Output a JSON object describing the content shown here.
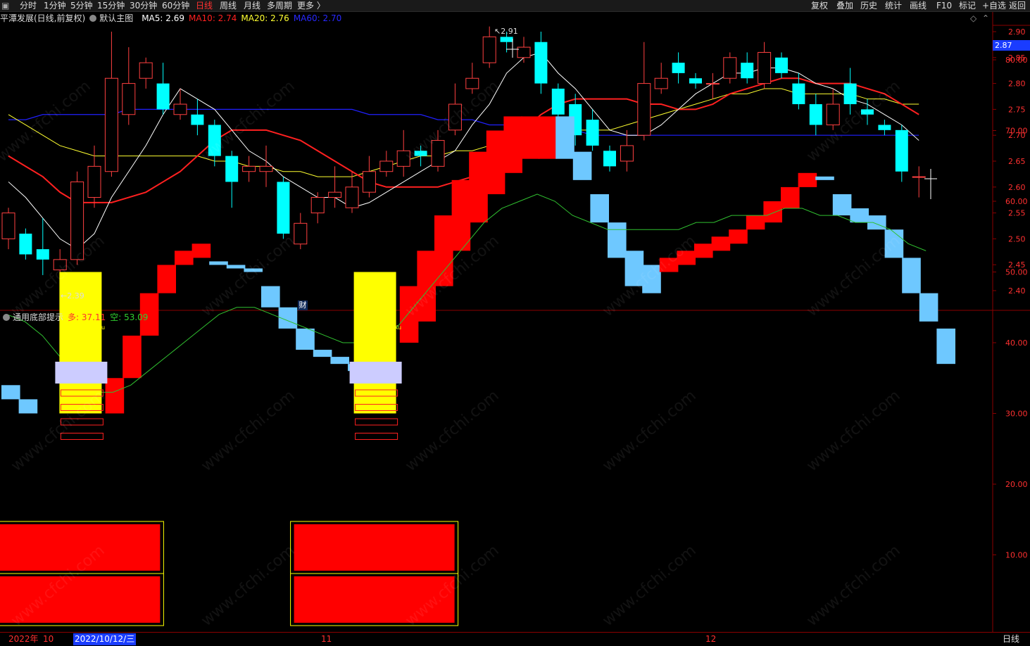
{
  "toolbar": {
    "left_items": [
      "分时",
      "1分钟",
      "5分钟",
      "15分钟",
      "30分钟",
      "60分钟",
      "日线",
      "周线",
      "月线",
      "多周期",
      "更多 〉"
    ],
    "active": "日线",
    "right_items": [
      "复权",
      "叠加",
      "历史",
      "统计",
      "画线",
      "F10",
      "标记",
      "+自选",
      "返回"
    ]
  },
  "main_chart": {
    "title": "平潭发展(日线,前复权)",
    "template": "默认主图",
    "ma5_label": "MA5: 2.69",
    "ma10_label": "MA10: 2.74",
    "ma20_label": "MA20: 2.76",
    "ma60_label": "MA60: 2.70",
    "colors": {
      "ma5": "#ffffff",
      "ma10": "#ff2020",
      "ma20": "#ffff30",
      "ma60": "#2020ff",
      "up": "#ff4040",
      "down": "#00ffff"
    },
    "price_ticks": [
      "2.90",
      "2.85",
      "2.80",
      "2.75",
      "2.70",
      "2.65",
      "2.60",
      "2.55",
      "2.50",
      "2.45",
      "2.40"
    ],
    "current_price": "2.87",
    "high_marker": "2.91",
    "low_marker": "2.39",
    "fin_marker": "财",
    "candles": [
      [
        2.5,
        2.55,
        2.48,
        2.56
      ],
      [
        2.51,
        2.47,
        2.46,
        2.52
      ],
      [
        2.48,
        2.46,
        2.43,
        2.54
      ],
      [
        2.44,
        2.46,
        2.39,
        2.48
      ],
      [
        2.46,
        2.61,
        2.45,
        2.63
      ],
      [
        2.58,
        2.64,
        2.56,
        2.68
      ],
      [
        2.63,
        2.81,
        2.62,
        2.9
      ],
      [
        2.74,
        2.8,
        2.72,
        2.87
      ],
      [
        2.81,
        2.84,
        2.79,
        2.85
      ],
      [
        2.8,
        2.75,
        2.74,
        2.84
      ],
      [
        2.74,
        2.76,
        2.73,
        2.79
      ],
      [
        2.74,
        2.72,
        2.7,
        2.77
      ],
      [
        2.72,
        2.66,
        2.64,
        2.73
      ],
      [
        2.66,
        2.61,
        2.56,
        2.67
      ],
      [
        2.63,
        2.64,
        2.61,
        2.66
      ],
      [
        2.63,
        2.64,
        2.6,
        2.68
      ],
      [
        2.61,
        2.51,
        2.5,
        2.62
      ],
      [
        2.49,
        2.53,
        2.48,
        2.55
      ],
      [
        2.55,
        2.58,
        2.53,
        2.59
      ],
      [
        2.58,
        2.59,
        2.56,
        2.64
      ],
      [
        2.56,
        2.6,
        2.55,
        2.63
      ],
      [
        2.59,
        2.63,
        2.58,
        2.66
      ],
      [
        2.63,
        2.65,
        2.62,
        2.67
      ],
      [
        2.64,
        2.67,
        2.62,
        2.71
      ],
      [
        2.67,
        2.66,
        2.64,
        2.68
      ],
      [
        2.64,
        2.69,
        2.63,
        2.71
      ],
      [
        2.71,
        2.76,
        2.7,
        2.8
      ],
      [
        2.79,
        2.81,
        2.78,
        2.84
      ],
      [
        2.84,
        2.89,
        2.83,
        2.91
      ],
      [
        2.89,
        2.88,
        2.86,
        2.9
      ],
      [
        2.85,
        2.87,
        2.84,
        2.89
      ],
      [
        2.88,
        2.8,
        2.78,
        2.9
      ],
      [
        2.79,
        2.74,
        2.72,
        2.8
      ],
      [
        2.76,
        2.7,
        2.68,
        2.78
      ],
      [
        2.73,
        2.68,
        2.67,
        2.75
      ],
      [
        2.67,
        2.64,
        2.63,
        2.68
      ],
      [
        2.65,
        2.68,
        2.63,
        2.71
      ],
      [
        2.7,
        2.8,
        2.69,
        2.88
      ],
      [
        2.79,
        2.81,
        2.78,
        2.84
      ],
      [
        2.84,
        2.82,
        2.8,
        2.86
      ],
      [
        2.81,
        2.8,
        2.79,
        2.82
      ],
      [
        2.8,
        2.8,
        2.77,
        2.82
      ],
      [
        2.81,
        2.85,
        2.8,
        2.86
      ],
      [
        2.84,
        2.81,
        2.8,
        2.86
      ],
      [
        2.8,
        2.86,
        2.79,
        2.88
      ],
      [
        2.85,
        2.82,
        2.81,
        2.86
      ],
      [
        2.8,
        2.76,
        2.75,
        2.82
      ],
      [
        2.76,
        2.72,
        2.7,
        2.78
      ],
      [
        2.72,
        2.76,
        2.71,
        2.79
      ],
      [
        2.8,
        2.76,
        2.74,
        2.83
      ],
      [
        2.75,
        2.74,
        2.72,
        2.77
      ],
      [
        2.72,
        2.71,
        2.7,
        2.73
      ],
      [
        2.71,
        2.63,
        2.61,
        2.72
      ],
      [
        2.62,
        2.62,
        2.58,
        2.64
      ]
    ],
    "ma5": [
      2.61,
      2.58,
      2.54,
      2.5,
      2.48,
      2.51,
      2.58,
      2.63,
      2.68,
      2.74,
      2.79,
      2.77,
      2.75,
      2.71,
      2.67,
      2.65,
      2.62,
      2.6,
      2.58,
      2.58,
      2.56,
      2.57,
      2.59,
      2.61,
      2.63,
      2.65,
      2.67,
      2.72,
      2.76,
      2.82,
      2.85,
      2.86,
      2.82,
      2.79,
      2.75,
      2.71,
      2.7,
      2.7,
      2.72,
      2.75,
      2.78,
      2.8,
      2.82,
      2.82,
      2.83,
      2.83,
      2.82,
      2.8,
      2.79,
      2.77,
      2.76,
      2.74,
      2.72,
      2.69
    ],
    "ma10": [
      2.66,
      2.64,
      2.62,
      2.59,
      2.57,
      2.57,
      2.57,
      2.58,
      2.59,
      2.61,
      2.63,
      2.66,
      2.69,
      2.71,
      2.71,
      2.71,
      2.7,
      2.69,
      2.67,
      2.65,
      2.63,
      2.61,
      2.6,
      2.6,
      2.6,
      2.6,
      2.61,
      2.62,
      2.65,
      2.68,
      2.71,
      2.74,
      2.76,
      2.77,
      2.77,
      2.77,
      2.77,
      2.76,
      2.76,
      2.75,
      2.75,
      2.76,
      2.78,
      2.79,
      2.8,
      2.81,
      2.81,
      2.8,
      2.8,
      2.8,
      2.79,
      2.78,
      2.76,
      2.74
    ],
    "ma20": [
      2.74,
      2.72,
      2.7,
      2.68,
      2.67,
      2.66,
      2.66,
      2.66,
      2.66,
      2.66,
      2.66,
      2.66,
      2.65,
      2.65,
      2.64,
      2.64,
      2.63,
      2.63,
      2.62,
      2.62,
      2.62,
      2.63,
      2.64,
      2.65,
      2.66,
      2.66,
      2.67,
      2.67,
      2.68,
      2.69,
      2.69,
      2.7,
      2.7,
      2.71,
      2.71,
      2.71,
      2.72,
      2.73,
      2.74,
      2.75,
      2.76,
      2.77,
      2.78,
      2.78,
      2.79,
      2.79,
      2.78,
      2.78,
      2.78,
      2.78,
      2.77,
      2.77,
      2.76,
      2.76
    ],
    "ma60": [
      2.73,
      2.73,
      2.74,
      2.74,
      2.74,
      2.74,
      2.74,
      2.75,
      2.75,
      2.75,
      2.75,
      2.75,
      2.75,
      2.75,
      2.75,
      2.75,
      2.75,
      2.75,
      2.75,
      2.75,
      2.75,
      2.74,
      2.74,
      2.74,
      2.74,
      2.73,
      2.73,
      2.73,
      2.72,
      2.72,
      2.72,
      2.71,
      2.71,
      2.71,
      2.7,
      2.7,
      2.7,
      2.7,
      2.7,
      2.7,
      2.7,
      2.7,
      2.7,
      2.7,
      2.7,
      2.7,
      2.7,
      2.7,
      2.7,
      2.7,
      2.7,
      2.7,
      2.7,
      2.7
    ]
  },
  "indicator": {
    "name": "通用底部提示",
    "long_label": "多: 37.11",
    "short_label": "空: 53.09",
    "small_mark": "7Ku",
    "ticks": [
      "80.00",
      "70.00",
      "60.00",
      "50.00",
      "40.00",
      "30.00",
      "20.00",
      "10.00"
    ],
    "colors": {
      "up": "#ff0000",
      "down": "#6ec8ff",
      "signal": "#ffff00",
      "line": "#30c030",
      "top": "#ccccff"
    },
    "signal_bars": [
      [
        4,
        30,
        50
      ],
      [
        21,
        30,
        50
      ]
    ],
    "steps": [
      [
        "d",
        0,
        32,
        34
      ],
      [
        "d",
        1,
        30,
        32
      ],
      [
        "u",
        6,
        30,
        35
      ],
      [
        "u",
        7,
        35,
        41
      ],
      [
        "u",
        8,
        41,
        47
      ],
      [
        "u",
        9,
        47,
        51
      ],
      [
        "u",
        10,
        51,
        53
      ],
      [
        "u",
        11,
        52,
        54
      ],
      [
        "d",
        12,
        51,
        51.5
      ],
      [
        "d",
        13,
        50.5,
        51
      ],
      [
        "d",
        14,
        50,
        50.5
      ],
      [
        "d",
        15,
        45,
        48
      ],
      [
        "d",
        16,
        42,
        45
      ],
      [
        "d",
        17,
        39,
        42
      ],
      [
        "d",
        18,
        38,
        39
      ],
      [
        "d",
        19,
        37,
        38
      ],
      [
        "d",
        20,
        36,
        37
      ],
      [
        "u",
        23,
        40,
        48
      ],
      [
        "u",
        24,
        43,
        53
      ],
      [
        "u",
        25,
        48,
        58
      ],
      [
        "u",
        26,
        53,
        63
      ],
      [
        "u",
        27,
        57,
        67
      ],
      [
        "u",
        28,
        61,
        70
      ],
      [
        "u",
        29,
        64,
        72
      ],
      [
        "u",
        30,
        66,
        72
      ],
      [
        "u",
        31,
        66,
        72
      ],
      [
        "d",
        32,
        66,
        72
      ],
      [
        "d",
        33,
        63,
        67
      ],
      [
        "d",
        34,
        57,
        61
      ],
      [
        "d",
        35,
        52,
        57
      ],
      [
        "d",
        36,
        48,
        53
      ],
      [
        "d",
        37,
        47,
        51
      ],
      [
        "u",
        38,
        50,
        52
      ],
      [
        "u",
        39,
        51,
        53
      ],
      [
        "u",
        40,
        52,
        54
      ],
      [
        "u",
        41,
        53,
        55
      ],
      [
        "u",
        42,
        54,
        56
      ],
      [
        "u",
        43,
        56,
        58
      ],
      [
        "u",
        44,
        57,
        60
      ],
      [
        "u",
        45,
        59,
        62
      ],
      [
        "u",
        46,
        62,
        64
      ],
      [
        "d",
        47,
        63,
        63.5
      ],
      [
        "d",
        48,
        58,
        61
      ],
      [
        "d",
        49,
        57,
        59
      ],
      [
        "d",
        50,
        56,
        58
      ],
      [
        "d",
        51,
        52,
        56
      ],
      [
        "d",
        52,
        47,
        52
      ],
      [
        "d",
        53,
        43,
        47
      ],
      [
        "d",
        54,
        37,
        42
      ]
    ],
    "curve": [
      44,
      43,
      41,
      38,
      35,
      33,
      33,
      34,
      36,
      38,
      40,
      42,
      44,
      45,
      45,
      44,
      43,
      42,
      41,
      40,
      40,
      41,
      42,
      45,
      48,
      51,
      54,
      57,
      59,
      60,
      61,
      60,
      58,
      57,
      56,
      56,
      56,
      56,
      56,
      57,
      57,
      58,
      58,
      58,
      59,
      59,
      58,
      58,
      57,
      57,
      56,
      54,
      53
    ]
  },
  "bottom": {
    "year": "2022年",
    "m10": "10",
    "date": "2022/10/12/三",
    "m11": "11",
    "m12": "12",
    "period": "日线"
  },
  "watermark": "www.cfchi.com"
}
